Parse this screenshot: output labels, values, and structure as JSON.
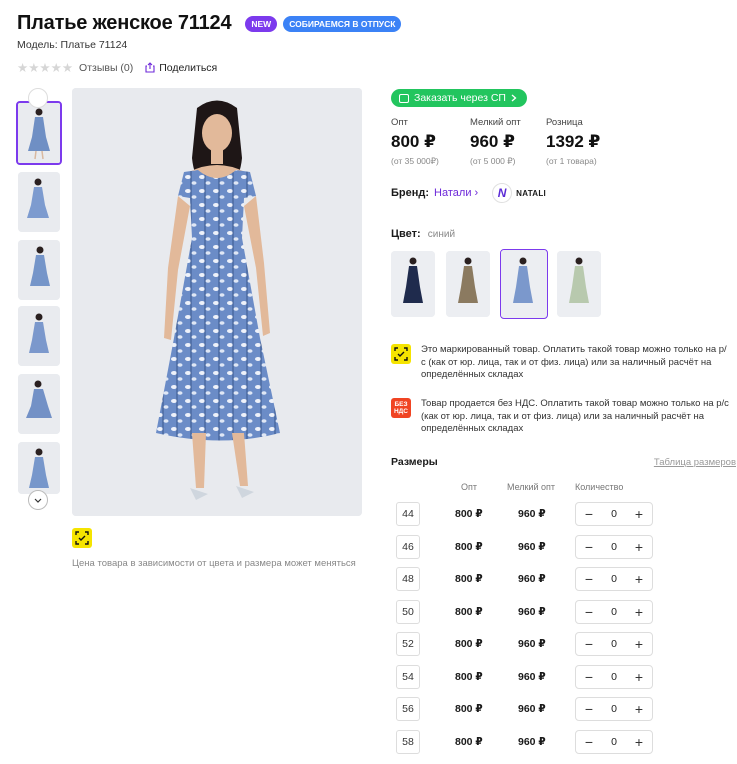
{
  "product": {
    "title": "Платье женское 71124",
    "badges": {
      "new": "NEW",
      "vacation": "СОБИРАЕМСЯ В ОТПУСК"
    },
    "model": "Модель: Платье 71124",
    "stars": "★★★★★",
    "reviews": "Отзывы (0)",
    "share": "Поделиться",
    "price_note": "Цена товара в зависимости от цвета и размера может меняться"
  },
  "order": {
    "sp_label": "Заказать через СП"
  },
  "prices": [
    {
      "label": "Опт",
      "value": "800 ₽",
      "note": "(от 35 000₽)"
    },
    {
      "label": "Мелкий опт",
      "value": "960 ₽",
      "note": "(от 5 000 ₽)"
    },
    {
      "label": "Розница",
      "value": "1392 ₽",
      "note": "(от 1 товара)"
    }
  ],
  "brand": {
    "label": "Бренд:",
    "name": "Натали",
    "logo_text": "NATALI"
  },
  "color": {
    "label": "Цвет:",
    "value": "синий"
  },
  "notices": [
    {
      "icon": "marking-icon",
      "text": "Это маркированный товар. Оплатить такой товар можно только на р/с (как от юр. лица, так и от физ. лица) или за наличный расчёт на определённых складах"
    },
    {
      "icon": "no-vat-icon",
      "icon_text": "БЕЗ НДС",
      "text": "Товар продается без НДС. Оплатить такой товар можно только на р/с (как от юр. лица, так и от физ. лица) или за наличный расчёт на определённых складах"
    }
  ],
  "sizes": {
    "title": "Размеры",
    "table_link": "Таблица размеров",
    "columns": {
      "opt": "Опт",
      "small_opt": "Мелкий опт",
      "qty": "Количество"
    },
    "rows": [
      {
        "size": "44",
        "opt": "800 ₽",
        "small_opt": "960 ₽",
        "qty": "0"
      },
      {
        "size": "46",
        "opt": "800 ₽",
        "small_opt": "960 ₽",
        "qty": "0"
      },
      {
        "size": "48",
        "opt": "800 ₽",
        "small_opt": "960 ₽",
        "qty": "0"
      },
      {
        "size": "50",
        "opt": "800 ₽",
        "small_opt": "960 ₽",
        "qty": "0"
      },
      {
        "size": "52",
        "opt": "800 ₽",
        "small_opt": "960 ₽",
        "qty": "0"
      },
      {
        "size": "54",
        "opt": "800 ₽",
        "small_opt": "960 ₽",
        "qty": "0"
      },
      {
        "size": "56",
        "opt": "800 ₽",
        "small_opt": "960 ₽",
        "qty": "0"
      },
      {
        "size": "58",
        "opt": "800 ₽",
        "small_opt": "960 ₽",
        "qty": "0"
      }
    ]
  },
  "colors": {
    "accent": "#7c3aed",
    "badge_blue": "#3b82f6",
    "green": "#22c55e",
    "marking_yellow": "#f5e400",
    "no_vat_red": "#f04423"
  }
}
